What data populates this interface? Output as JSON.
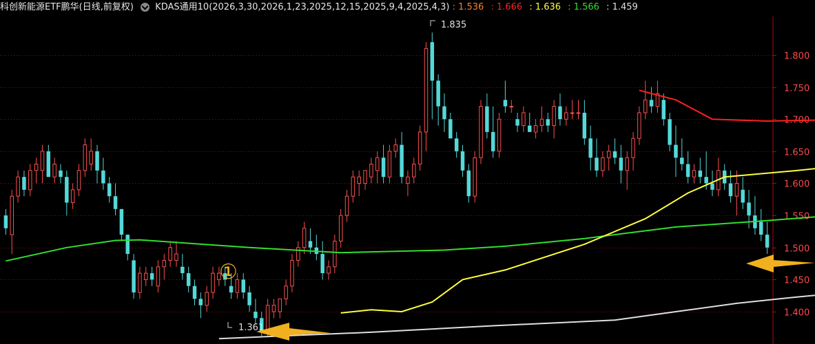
{
  "header": {
    "title": "科创新能源ETF鹏华(日线,前复权)",
    "indicator": "KDAS通用10(2026,3,30,2026,1,23,2025,12,15,2025,9,4,2025,4,3)",
    "values": [
      {
        "text": ": 1.536",
        "color": "#ff7f27"
      },
      {
        "text": ": 1.666",
        "color": "#ff2020"
      },
      {
        "text": ": 1.636",
        "color": "#ffff40"
      },
      {
        "text": ": 1.566",
        "color": "#30e030"
      },
      {
        "text": ": 1.459",
        "color": "#e0e0e0"
      }
    ]
  },
  "colors": {
    "up": "#ff5050",
    "down": "#54d8d8",
    "grid": "#8a1010",
    "axis": "#a01010"
  },
  "annotations": {
    "high_label": "1.835",
    "low_label": "1.361",
    "marker": "①"
  },
  "chart_data": {
    "type": "candlestick",
    "ylim": [
      1.355,
      1.86
    ],
    "yticks": [
      "1.800",
      "1.750",
      "1.700",
      "1.650",
      "1.600",
      "1.550",
      "1.500",
      "1.450",
      "1.400"
    ],
    "ohlc": [
      [
        1.55,
        1.56,
        1.52,
        1.53
      ],
      [
        1.52,
        1.59,
        1.49,
        1.58
      ],
      [
        1.58,
        1.62,
        1.57,
        1.61
      ],
      [
        1.61,
        1.62,
        1.58,
        1.59
      ],
      [
        1.59,
        1.63,
        1.58,
        1.62
      ],
      [
        1.62,
        1.64,
        1.6,
        1.63
      ],
      [
        1.62,
        1.66,
        1.6,
        1.65
      ],
      [
        1.65,
        1.66,
        1.61,
        1.61
      ],
      [
        1.61,
        1.64,
        1.6,
        1.63
      ],
      [
        1.62,
        1.63,
        1.6,
        1.61
      ],
      [
        1.61,
        1.62,
        1.55,
        1.57
      ],
      [
        1.57,
        1.6,
        1.56,
        1.59
      ],
      [
        1.59,
        1.63,
        1.58,
        1.62
      ],
      [
        1.62,
        1.67,
        1.61,
        1.66
      ],
      [
        1.63,
        1.67,
        1.62,
        1.65
      ],
      [
        1.65,
        1.66,
        1.6,
        1.62
      ],
      [
        1.62,
        1.64,
        1.59,
        1.6
      ],
      [
        1.6,
        1.61,
        1.57,
        1.58
      ],
      [
        1.58,
        1.6,
        1.55,
        1.56
      ],
      [
        1.56,
        1.56,
        1.51,
        1.52
      ],
      [
        1.52,
        1.52,
        1.48,
        1.49
      ],
      [
        1.48,
        1.49,
        1.42,
        1.43
      ],
      [
        1.43,
        1.47,
        1.42,
        1.46
      ],
      [
        1.45,
        1.47,
        1.44,
        1.46
      ],
      [
        1.46,
        1.47,
        1.44,
        1.45
      ],
      [
        1.44,
        1.48,
        1.43,
        1.47
      ],
      [
        1.47,
        1.49,
        1.45,
        1.48
      ],
      [
        1.48,
        1.51,
        1.47,
        1.5
      ],
      [
        1.48,
        1.51,
        1.47,
        1.49
      ],
      [
        1.47,
        1.49,
        1.45,
        1.46
      ],
      [
        1.46,
        1.47,
        1.43,
        1.44
      ],
      [
        1.44,
        1.45,
        1.41,
        1.42
      ],
      [
        1.42,
        1.43,
        1.39,
        1.41
      ],
      [
        1.41,
        1.44,
        1.4,
        1.43
      ],
      [
        1.43,
        1.47,
        1.42,
        1.46
      ],
      [
        1.45,
        1.47,
        1.44,
        1.46
      ],
      [
        1.46,
        1.47,
        1.44,
        1.45
      ],
      [
        1.44,
        1.46,
        1.42,
        1.43
      ],
      [
        1.43,
        1.46,
        1.42,
        1.45
      ],
      [
        1.45,
        1.46,
        1.42,
        1.43
      ],
      [
        1.43,
        1.44,
        1.4,
        1.41
      ],
      [
        1.4,
        1.42,
        1.38,
        1.39
      ],
      [
        1.39,
        1.4,
        1.36,
        1.37
      ],
      [
        1.37,
        1.42,
        1.36,
        1.41
      ],
      [
        1.4,
        1.42,
        1.39,
        1.41
      ],
      [
        1.4,
        1.42,
        1.39,
        1.42
      ],
      [
        1.42,
        1.45,
        1.41,
        1.44
      ],
      [
        1.44,
        1.49,
        1.43,
        1.48
      ],
      [
        1.48,
        1.51,
        1.47,
        1.5
      ],
      [
        1.5,
        1.54,
        1.49,
        1.53
      ],
      [
        1.51,
        1.53,
        1.49,
        1.5
      ],
      [
        1.5,
        1.52,
        1.48,
        1.49
      ],
      [
        1.49,
        1.51,
        1.45,
        1.46
      ],
      [
        1.46,
        1.48,
        1.45,
        1.47
      ],
      [
        1.47,
        1.52,
        1.46,
        1.51
      ],
      [
        1.51,
        1.56,
        1.5,
        1.55
      ],
      [
        1.55,
        1.59,
        1.54,
        1.58
      ],
      [
        1.58,
        1.62,
        1.57,
        1.61
      ],
      [
        1.6,
        1.62,
        1.58,
        1.61
      ],
      [
        1.6,
        1.62,
        1.59,
        1.62
      ],
      [
        1.61,
        1.64,
        1.6,
        1.63
      ],
      [
        1.62,
        1.65,
        1.6,
        1.64
      ],
      [
        1.64,
        1.66,
        1.6,
        1.61
      ],
      [
        1.61,
        1.66,
        1.6,
        1.65
      ],
      [
        1.65,
        1.67,
        1.64,
        1.66
      ],
      [
        1.66,
        1.68,
        1.6,
        1.61
      ],
      [
        1.6,
        1.62,
        1.58,
        1.61
      ],
      [
        1.61,
        1.64,
        1.6,
        1.63
      ],
      [
        1.63,
        1.69,
        1.62,
        1.68
      ],
      [
        1.68,
        1.82,
        1.65,
        1.81
      ],
      [
        1.82,
        1.835,
        1.7,
        1.76
      ],
      [
        1.76,
        1.77,
        1.69,
        1.72
      ],
      [
        1.72,
        1.74,
        1.68,
        1.7
      ],
      [
        1.7,
        1.71,
        1.67,
        1.67
      ],
      [
        1.67,
        1.68,
        1.64,
        1.65
      ],
      [
        1.65,
        1.66,
        1.61,
        1.62
      ],
      [
        1.62,
        1.63,
        1.57,
        1.58
      ],
      [
        1.58,
        1.65,
        1.57,
        1.64
      ],
      [
        1.64,
        1.73,
        1.63,
        1.72
      ],
      [
        1.72,
        1.74,
        1.67,
        1.68
      ],
      [
        1.68,
        1.72,
        1.64,
        1.65
      ],
      [
        1.65,
        1.71,
        1.64,
        1.7
      ],
      [
        1.73,
        1.76,
        1.71,
        1.72
      ],
      [
        1.72,
        1.73,
        1.71,
        1.72
      ],
      [
        1.7,
        1.71,
        1.68,
        1.69
      ],
      [
        1.69,
        1.72,
        1.68,
        1.71
      ],
      [
        1.69,
        1.71,
        1.68,
        1.68
      ],
      [
        1.68,
        1.7,
        1.67,
        1.69
      ],
      [
        1.69,
        1.72,
        1.68,
        1.7
      ],
      [
        1.7,
        1.71,
        1.68,
        1.69
      ],
      [
        1.69,
        1.73,
        1.67,
        1.72
      ],
      [
        1.72,
        1.74,
        1.69,
        1.7
      ],
      [
        1.7,
        1.72,
        1.69,
        1.71
      ],
      [
        1.71,
        1.73,
        1.7,
        1.71
      ],
      [
        1.71,
        1.73,
        1.7,
        1.71
      ],
      [
        1.71,
        1.73,
        1.66,
        1.67
      ],
      [
        1.67,
        1.69,
        1.62,
        1.64
      ],
      [
        1.64,
        1.67,
        1.61,
        1.62
      ],
      [
        1.62,
        1.65,
        1.61,
        1.64
      ],
      [
        1.64,
        1.66,
        1.62,
        1.65
      ],
      [
        1.65,
        1.67,
        1.63,
        1.64
      ],
      [
        1.64,
        1.66,
        1.6,
        1.62
      ],
      [
        1.62,
        1.65,
        1.59,
        1.64
      ],
      [
        1.64,
        1.68,
        1.62,
        1.67
      ],
      [
        1.67,
        1.72,
        1.66,
        1.71
      ],
      [
        1.71,
        1.76,
        1.7,
        1.73
      ],
      [
        1.73,
        1.75,
        1.71,
        1.72
      ],
      [
        1.72,
        1.76,
        1.71,
        1.74
      ],
      [
        1.73,
        1.74,
        1.69,
        1.7
      ],
      [
        1.7,
        1.71,
        1.65,
        1.66
      ],
      [
        1.66,
        1.69,
        1.61,
        1.64
      ],
      [
        1.64,
        1.67,
        1.62,
        1.63
      ],
      [
        1.63,
        1.65,
        1.6,
        1.61
      ],
      [
        1.61,
        1.63,
        1.6,
        1.62
      ],
      [
        1.62,
        1.64,
        1.6,
        1.61
      ],
      [
        1.61,
        1.65,
        1.59,
        1.6
      ],
      [
        1.6,
        1.62,
        1.58,
        1.59
      ],
      [
        1.59,
        1.64,
        1.58,
        1.62
      ],
      [
        1.62,
        1.63,
        1.59,
        1.6
      ],
      [
        1.6,
        1.62,
        1.57,
        1.58
      ],
      [
        1.58,
        1.62,
        1.55,
        1.6
      ],
      [
        1.59,
        1.61,
        1.56,
        1.57
      ],
      [
        1.57,
        1.59,
        1.53,
        1.55
      ],
      [
        1.55,
        1.58,
        1.52,
        1.53
      ],
      [
        1.54,
        1.56,
        1.51,
        1.52
      ],
      [
        1.52,
        1.54,
        1.49,
        1.5
      ]
    ],
    "series": [
      {
        "color": "#30e030",
        "points": [
          [
            0,
            1.479
          ],
          [
            10,
            1.5
          ],
          [
            18,
            1.511
          ],
          [
            22,
            1.512
          ],
          [
            40,
            1.5
          ],
          [
            55,
            1.492
          ],
          [
            72,
            1.496
          ],
          [
            82,
            1.502
          ],
          [
            95,
            1.514
          ],
          [
            110,
            1.532
          ],
          [
            125,
            1.542
          ],
          [
            140,
            1.553
          ],
          [
            160,
            1.562
          ],
          [
            175,
            1.566
          ],
          [
            182,
            1.567
          ]
        ]
      },
      {
        "color": "#ffff40",
        "points": [
          [
            55,
            1.398
          ],
          [
            60,
            1.403
          ],
          [
            65,
            1.4
          ],
          [
            70,
            1.415
          ],
          [
            75,
            1.45
          ],
          [
            82,
            1.465
          ],
          [
            95,
            1.505
          ],
          [
            105,
            1.545
          ],
          [
            112,
            1.585
          ],
          [
            118,
            1.61
          ],
          [
            130,
            1.62
          ],
          [
            140,
            1.63
          ],
          [
            150,
            1.642
          ],
          [
            160,
            1.646
          ],
          [
            170,
            1.645
          ],
          [
            182,
            1.636
          ]
        ]
      },
      {
        "color": "#ff2020",
        "points": [
          [
            104,
            1.745
          ],
          [
            110,
            1.73
          ],
          [
            116,
            1.7
          ],
          [
            125,
            1.697
          ],
          [
            135,
            1.699
          ],
          [
            145,
            1.697
          ],
          [
            155,
            1.691
          ],
          [
            162,
            1.696
          ],
          [
            170,
            1.69
          ],
          [
            182,
            1.666
          ]
        ]
      },
      {
        "color": "#e0e0e0",
        "points": [
          [
            35,
            1.358
          ],
          [
            60,
            1.368
          ],
          [
            80,
            1.378
          ],
          [
            100,
            1.387
          ],
          [
            110,
            1.4
          ],
          [
            120,
            1.413
          ],
          [
            130,
            1.423
          ],
          [
            140,
            1.432
          ],
          [
            150,
            1.44
          ],
          [
            160,
            1.448
          ],
          [
            170,
            1.454
          ],
          [
            182,
            1.459
          ]
        ]
      },
      {
        "color": "#ff7f27",
        "points": [
          [
            176,
            1.546
          ],
          [
            179,
            1.546
          ],
          [
            181,
            1.536
          ]
        ]
      }
    ]
  }
}
